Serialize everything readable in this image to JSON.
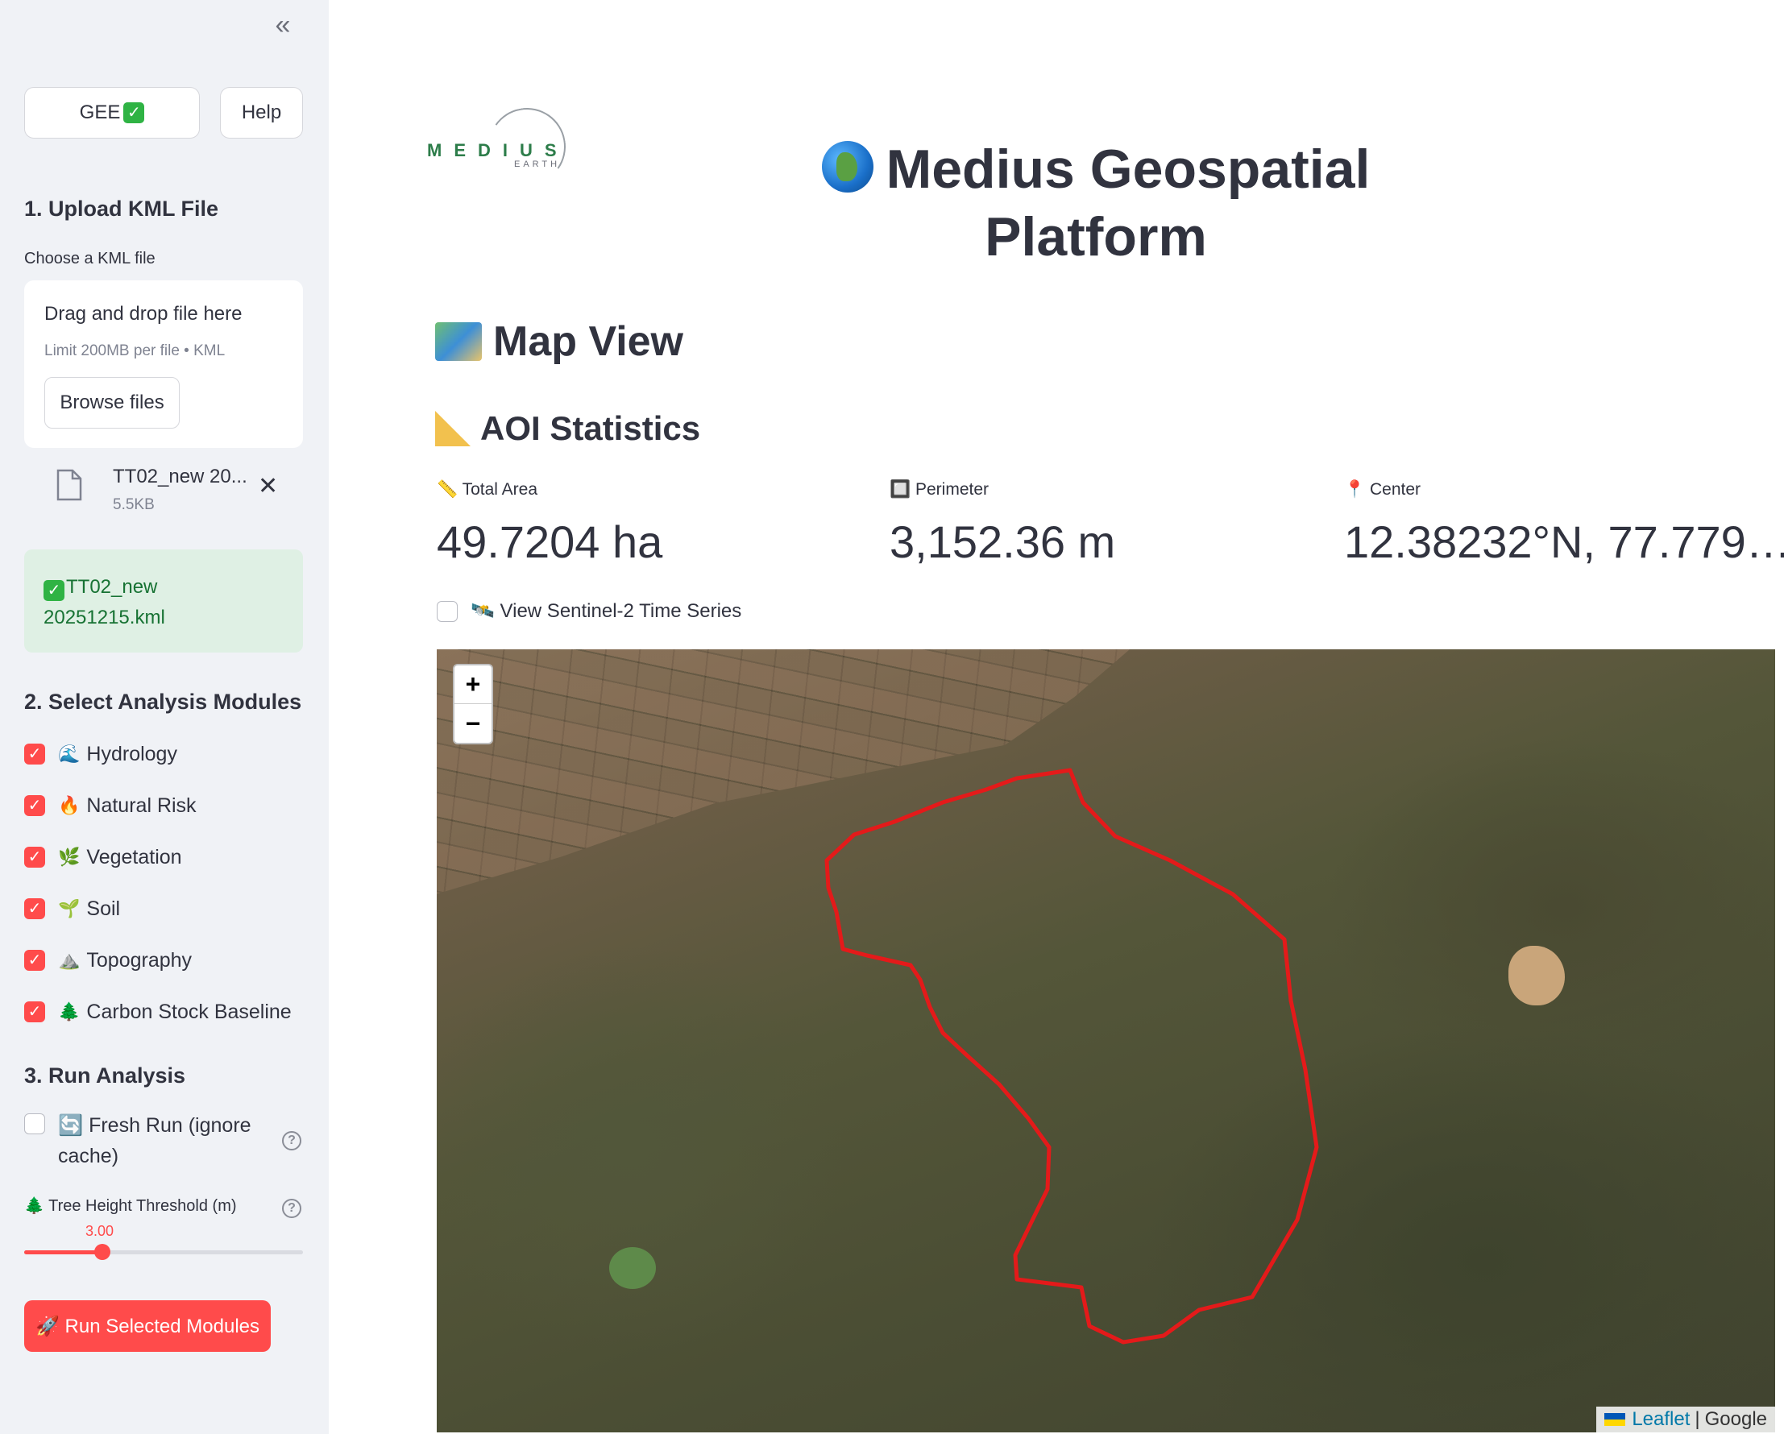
{
  "sidebar": {
    "collapse_icon": "«",
    "gee_label": "GEE",
    "help_label": "Help",
    "upload_heading": "1. Upload KML File",
    "choose_label": "Choose a KML file",
    "dropzone_title": "Drag and drop file here",
    "dropzone_limit": "Limit 200MB per file • KML",
    "browse_label": "Browse files",
    "file_name": "TT02_new 20...",
    "file_size": "5.5KB",
    "success_message": "TT02_new 20251215.kml",
    "modules_heading": "2. Select Analysis Modules",
    "modules": [
      {
        "emoji": "🌊",
        "label": "Hydrology",
        "checked": true
      },
      {
        "emoji": "🔥",
        "label": "Natural Risk",
        "checked": true
      },
      {
        "emoji": "🌿",
        "label": "Vegetation",
        "checked": true
      },
      {
        "emoji": "🌱",
        "label": "Soil",
        "checked": true
      },
      {
        "emoji": "⛰️",
        "label": "Topography",
        "checked": true
      },
      {
        "emoji": "🌲",
        "label": "Carbon Stock Baseline",
        "checked": true
      }
    ],
    "run_heading": "3. Run Analysis",
    "fresh_run_label": "🔄 Fresh Run (ignore cache)",
    "fresh_run_checked": false,
    "tree_height_label": "🌲 Tree Height Threshold (m)",
    "tree_height_value": "3.00",
    "tree_height_fraction": 0.28,
    "run_button_label": "🚀 Run Selected Modules"
  },
  "main": {
    "logo_text": "MEDIUS",
    "logo_sub": "EARTH",
    "title": "Medius Geospatial Platform",
    "map_view_heading": "Map View",
    "aoi_heading": "AOI Statistics",
    "metrics": [
      {
        "label": "📏 Total Area",
        "value": "49.7204 ha"
      },
      {
        "label": "🔲 Perimeter",
        "value": "3,152.36 m"
      },
      {
        "label": "📍 Center",
        "value": "12.38232°N, 77.779…"
      }
    ],
    "sentinel_label": "🛰️ View Sentinel-2 Time Series",
    "sentinel_checked": false
  },
  "map": {
    "zoom_in": "+",
    "zoom_out": "−",
    "attribution_leaflet": "Leaflet",
    "attribution_sep": "|",
    "attribution_google": "Google",
    "aoi_color": "#e41a1a"
  },
  "colors": {
    "accent": "#ff4b4b",
    "sidebar_bg": "#f0f2f6",
    "success_bg": "#dff0e4",
    "success_text": "#177233"
  }
}
